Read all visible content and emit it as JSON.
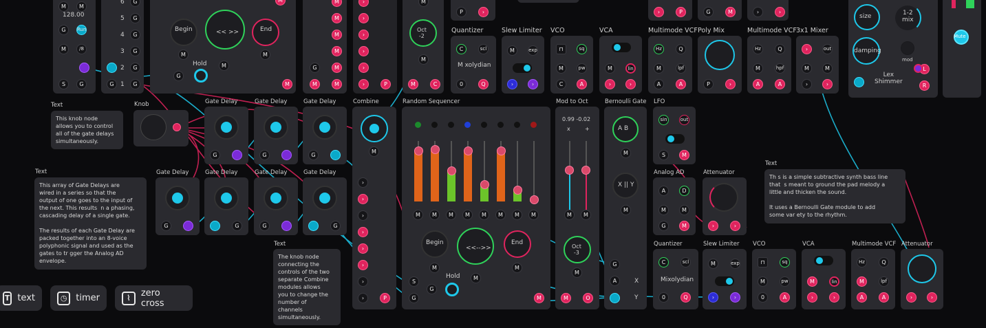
{
  "titles": {
    "quantizer1": "Quantizer",
    "slew1": "Slew Limiter",
    "vco1": "VCO",
    "vca1": "VCA",
    "vcf1": "Multimode VCF",
    "polymix": "Poly Mix",
    "vcf2": "Multimode VCF",
    "mixer3": "3x1 Mixer",
    "text1": "Text",
    "knob": "Knob",
    "gd1": "Gate Delay",
    "gd2": "Gate Delay",
    "gd3": "Gate Delay",
    "combine1": "Combine",
    "randseq": "Random Sequencer",
    "mod2oct": "Mod to Oct",
    "bernoulli": "Bernoulli Gate",
    "lfo": "LFO",
    "text2": "Text",
    "gd4": "Gate Delay",
    "gd5": "Gate Delay",
    "gd6": "Gate Delay",
    "gd7": "Gate Delay",
    "analogad": "Analog AD",
    "attenuator1": "Attenuator",
    "text3": "Text",
    "text4": "Text",
    "quantizer2": "Quantizer",
    "slew2": "Slew Limiter",
    "vco2": "VCO",
    "vca2": "VCA",
    "vcf3": "Multimode VCF",
    "attenuator2": "Attenuator"
  },
  "notes": {
    "knob_note": "This knob node\nallows you to control\nall of the gate delays\nsimultaneously.",
    "array_note": "This array of Gate Delays are\nwired in a series so that the\noutput of one goes to the input of\nthe next. This results  n a phasing,\ncascading delay of a single gate.\n\nThe results of each Gate Delay are\npacked together into an 8-voice\npolyphonic signal and used as the\ngates to tr gger the Analog AD\nenvelope.",
    "combine_note": "The knob node\nconnecting the\ncontrols of the two\nseparate Combine\nmodules allows\nyou to change the\nnumber of\nchannels\nsimultaneously.",
    "bass_note": "Th s is a simple subtractive synth bass line\nthat  s meant to ground the pad melody a\nlittle and thicken the sound.\n\nIt uses a Bernoulli Gate module to add\nsome var ety to the rhythm."
  },
  "labels": {
    "tempo": "128.00",
    "run": "Run",
    "div": "/8",
    "begin": "Begin",
    "end": "End",
    "arrows": "<< >>",
    "hold": "Hold",
    "oct_top": "Oct\n-2",
    "oct_bot": "Oct\n-3",
    "scale_top": "M xolydian",
    "scale_bot": "Mixolydian",
    "mod_vals": "0.99  -0.02",
    "ab": "A  B",
    "xy": "X || Y",
    "lex": "Lex\nShimmer",
    "size": "size",
    "mix": "1-2\nmix",
    "damping": "damping",
    "mod": "mod",
    "mute": "Mute",
    "begin2": "Begin",
    "end2": "End",
    "arrows2": "<<-->>",
    "hold2": "Hold"
  },
  "toolbar": [
    {
      "icon": "text-icon",
      "glyph": "T",
      "label": "text"
    },
    {
      "icon": "timer-icon",
      "glyph": "◷",
      "label": "timer"
    },
    {
      "icon": "zero-cross-icon",
      "glyph": "⌇",
      "label": "zero cross"
    }
  ],
  "colors": {
    "pink": "#e0245e",
    "cyan": "#1ec8ea",
    "green": "#2fd25a",
    "orange": "#e0641a",
    "bg": "#0b0b0d"
  },
  "sequencer_bars": [
    0.85,
    0.88,
    0.52,
    0.85,
    0.3,
    0.85,
    0.2,
    0.05
  ]
}
